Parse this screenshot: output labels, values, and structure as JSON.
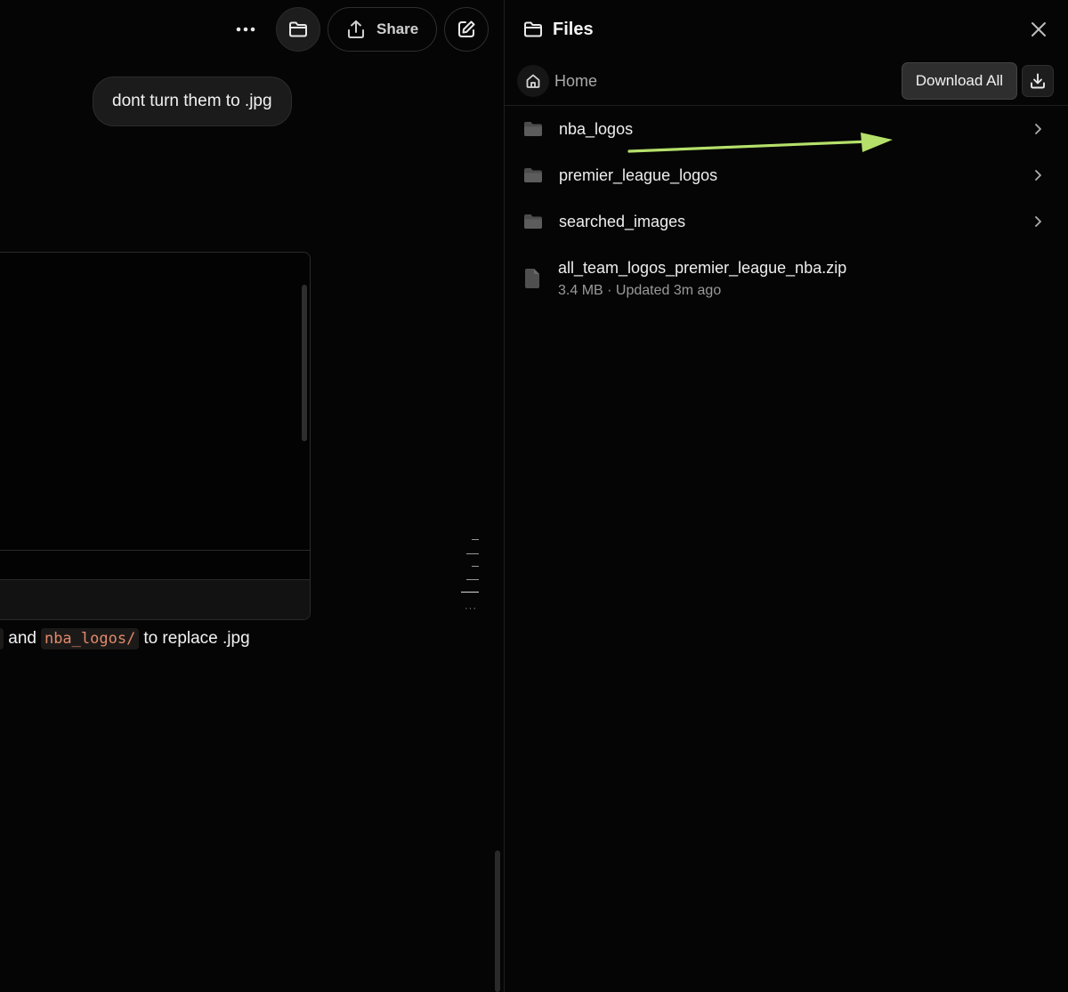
{
  "toolbar": {
    "share_label": "Share"
  },
  "chat": {
    "user_message": "dont turn them to .jpg",
    "reply": {
      "code_1": "/",
      "text_1": "and",
      "code_2": "nba_logos/",
      "text_2": "to replace .jpg"
    }
  },
  "files_panel": {
    "title": "Files",
    "breadcrumb_home": "Home",
    "download_all_label": "Download All",
    "items": [
      {
        "name": "nba_logos",
        "type": "folder"
      },
      {
        "name": "premier_league_logos",
        "type": "folder"
      },
      {
        "name": "searched_images",
        "type": "folder"
      },
      {
        "name": "all_team_logos_premier_league_nba.zip",
        "type": "file",
        "meta": "3.4 MB · Updated 3m ago"
      }
    ]
  },
  "colors": {
    "background": "#050505",
    "annotation_arrow": "#b5e06a",
    "inline_code": "#e08a6a"
  },
  "icons": [
    "more-icon",
    "folder-icon",
    "share-icon",
    "edit-icon",
    "close-icon",
    "home-icon",
    "download-icon",
    "chevron-right-icon",
    "file-icon"
  ]
}
